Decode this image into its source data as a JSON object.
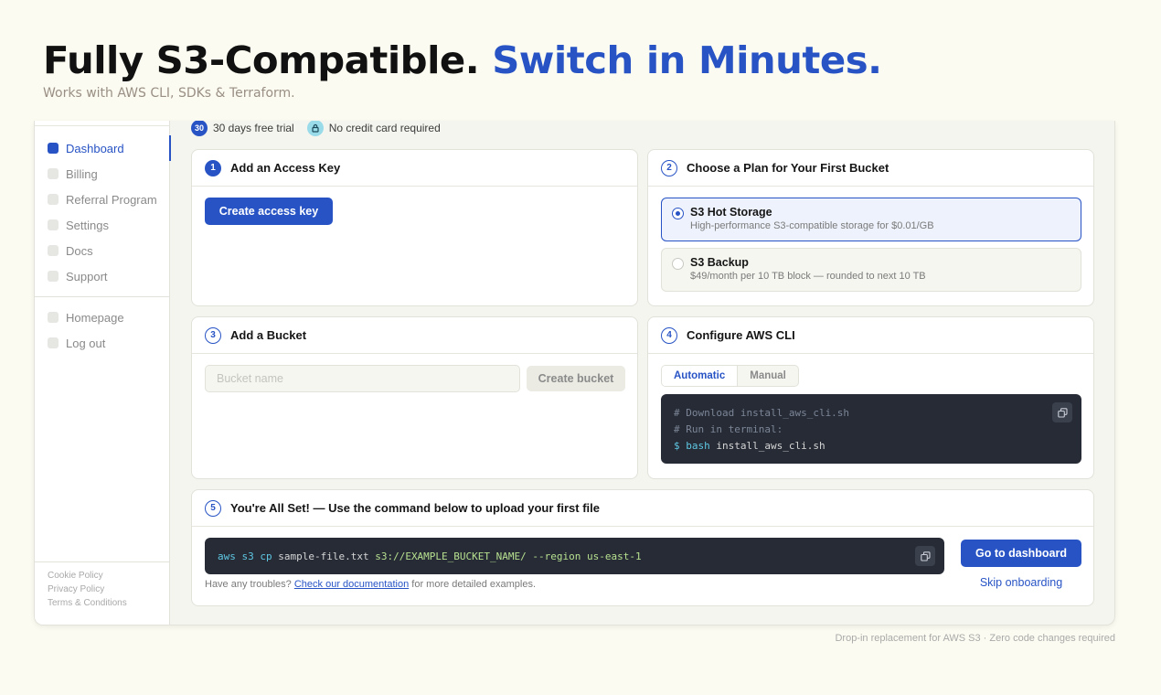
{
  "hero": {
    "title_main": "Fully S3-Compatible.",
    "title_accent": "Switch in Minutes.",
    "subtitle": "Works with AWS CLI, SDKs & Terraform."
  },
  "colors": {
    "accent": "#2753c5",
    "background": "#fbfbf1",
    "code_bg": "#262b36"
  },
  "sidebar": {
    "items": [
      {
        "label": "Dashboard",
        "active": true
      },
      {
        "label": "Billing"
      },
      {
        "label": "Referral Program"
      },
      {
        "label": "Settings"
      },
      {
        "label": "Docs"
      },
      {
        "label": "Support"
      }
    ],
    "secondary_items": [
      {
        "label": "Homepage"
      },
      {
        "label": "Log out"
      }
    ],
    "footer_links": [
      "Cookie Policy",
      "Privacy Policy",
      "Terms & Conditions"
    ]
  },
  "badges": {
    "trial_days": "30",
    "trial_label": "30 days free trial",
    "lock_icon": "lock-icon",
    "no_card_label": "No credit card required"
  },
  "step1": {
    "number": "1",
    "title": "Add an Access Key",
    "button": "Create access key"
  },
  "step2": {
    "number": "2",
    "title": "Choose a Plan for Your First Bucket",
    "plans": [
      {
        "name": "S3 Hot Storage",
        "description": "High-performance S3-compatible storage for $0.01/GB",
        "selected": true
      },
      {
        "name": "S3 Backup",
        "description": "$49/month per 10 TB block — rounded to next 10 TB",
        "selected": false
      }
    ]
  },
  "step3": {
    "number": "3",
    "title": "Add a Bucket",
    "input_placeholder": "Bucket name",
    "button": "Create bucket"
  },
  "step4": {
    "number": "4",
    "title": "Configure AWS CLI",
    "tabs": [
      "Automatic",
      "Manual"
    ],
    "active_tab": "Automatic",
    "code": {
      "line1": "# Download install_aws_cli.sh",
      "line2": "# Run in terminal:",
      "line3_prompt": "$ bash",
      "line3_arg": "install_aws_cli.sh"
    }
  },
  "step5": {
    "number": "5",
    "title": "You're All Set! — Use the command below to upload your first file",
    "command": {
      "cmd": "aws s3 cp",
      "file": "sample-file.txt",
      "target": "s3://EXAMPLE_BUCKET_NAME/",
      "flag": "--region us-east-1"
    },
    "help_prefix": "Have any troubles?",
    "help_link": "Check our documentation",
    "help_suffix": "for more detailed examples.",
    "primary_button": "Go to dashboard",
    "secondary_link": "Skip onboarding"
  },
  "footer_note": "Drop-in replacement for AWS S3 · Zero code changes required"
}
